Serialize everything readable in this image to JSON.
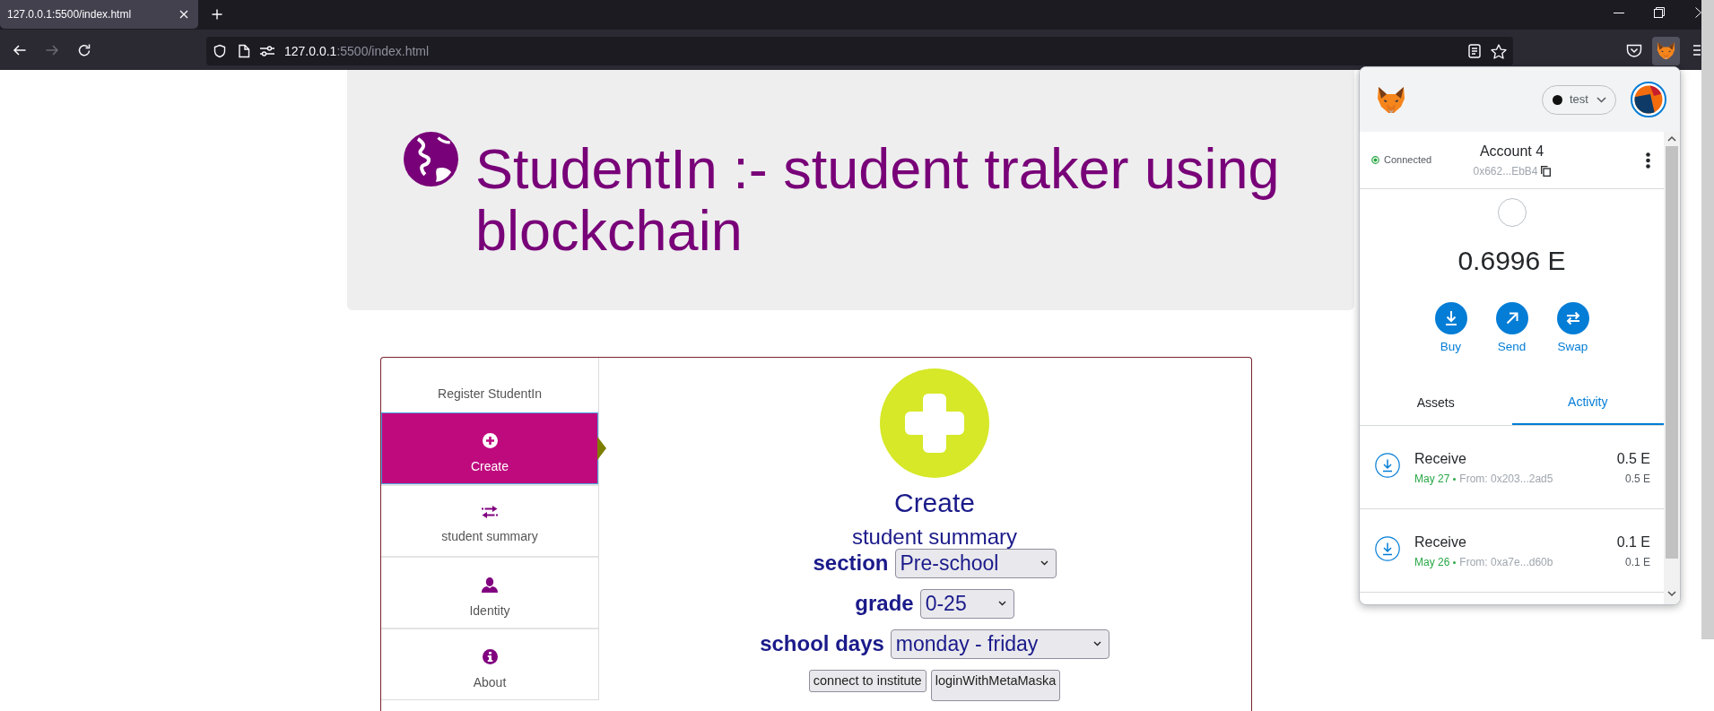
{
  "browser": {
    "tabs": [
      {
        "title": "127.0.0.1:5500/index.html",
        "selected": true
      }
    ],
    "forward": {
      "disabled": true
    },
    "url": {
      "host": "127.0.0.1",
      "path": ":5500/index.html"
    }
  },
  "page": {
    "header": {
      "title": "StudentIn :- student traker using blockchain"
    },
    "sidebar": {
      "heading": "Register StudentIn",
      "items": [
        {
          "label": "Create",
          "selected": true
        },
        {
          "label": "student summary",
          "selected": false
        },
        {
          "label": "Identity",
          "selected": false
        },
        {
          "label": "About",
          "selected": false
        }
      ]
    },
    "form": {
      "title": "Create",
      "subtitle": "student summary",
      "fields": [
        {
          "label": "section",
          "value": "Pre-school"
        },
        {
          "label": "grade",
          "value": "0-25"
        },
        {
          "label": "school days",
          "value": "monday - friday"
        }
      ],
      "buttons": [
        "connect to institute",
        "loginWithMetaMaska"
      ]
    }
  },
  "wallet": {
    "network": "test",
    "status": "Connected",
    "account": "Account 4",
    "address": "0x662...EbB4",
    "balance": "0.6996 E",
    "actions": [
      "Buy",
      "Send",
      "Swap"
    ],
    "tabs": [
      {
        "label": "Assets",
        "selected": false
      },
      {
        "label": "Activity",
        "selected": true
      }
    ],
    "activity": [
      {
        "title": "Receive",
        "date": "May 27",
        "from": "From: 0x203...2ad5",
        "amount": "0.5 E",
        "amount_secondary": "0.5 E"
      },
      {
        "title": "Receive",
        "date": "May 26",
        "from": "From: 0xa7e...d60b",
        "amount": "0.1 E",
        "amount_secondary": "0.1 E"
      }
    ]
  }
}
